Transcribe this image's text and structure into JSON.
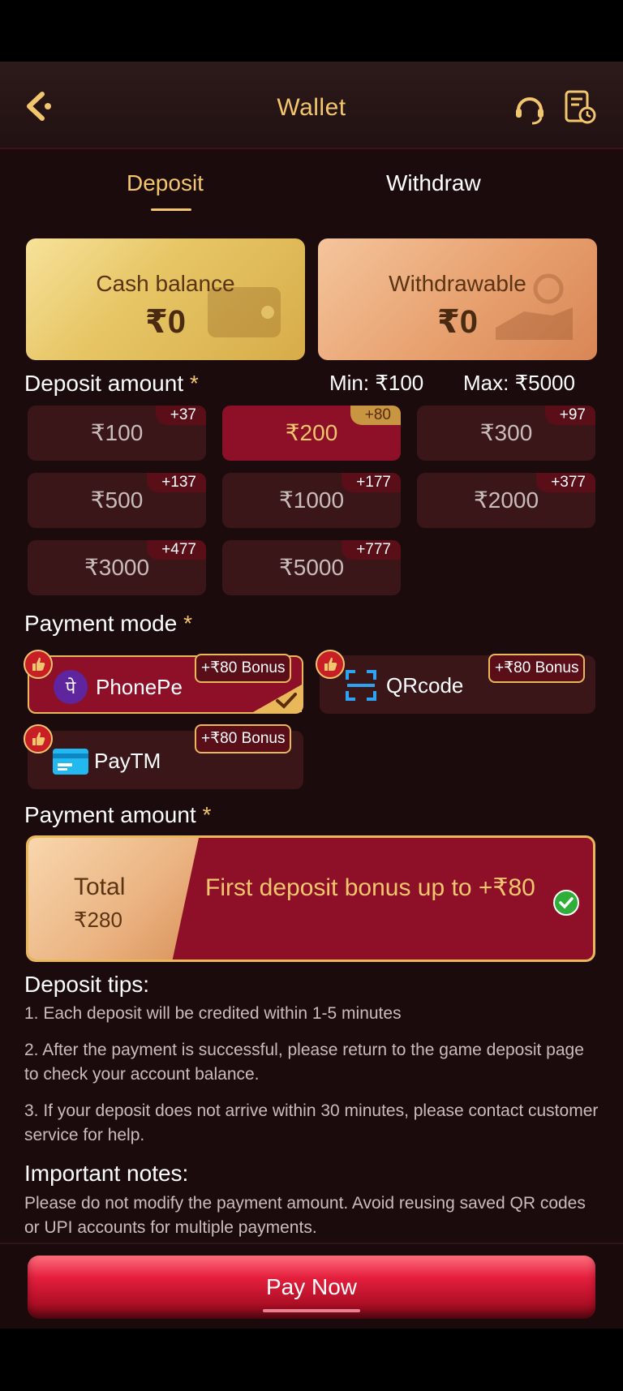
{
  "header": {
    "title": "Wallet",
    "back_icon": "back-arrow-icon",
    "support_icon": "headset-icon",
    "history_icon": "history-icon"
  },
  "tabs": [
    {
      "label": "Deposit",
      "active": true
    },
    {
      "label": "Withdraw",
      "active": false
    }
  ],
  "balances": {
    "cash": {
      "label": "Cash balance",
      "value": "₹0"
    },
    "withdrawable": {
      "label": "Withdrawable",
      "value": "₹0"
    }
  },
  "deposit": {
    "label": "Deposit amount",
    "required_mark": "*",
    "min": "Min: ₹100",
    "max": "Max: ₹5000",
    "amounts": [
      {
        "value": "₹100",
        "bonus": "+37",
        "selected": false
      },
      {
        "value": "₹200",
        "bonus": "+80",
        "selected": true
      },
      {
        "value": "₹300",
        "bonus": "+97",
        "selected": false
      },
      {
        "value": "₹500",
        "bonus": "+137",
        "selected": false
      },
      {
        "value": "₹1000",
        "bonus": "+177",
        "selected": false
      },
      {
        "value": "₹2000",
        "bonus": "+377",
        "selected": false
      },
      {
        "value": "₹3000",
        "bonus": "+477",
        "selected": false
      },
      {
        "value": "₹5000",
        "bonus": "+777",
        "selected": false
      }
    ]
  },
  "payment_mode": {
    "label": "Payment mode",
    "required_mark": "*",
    "options": [
      {
        "name": "PhonePe",
        "bonus": "+₹80 Bonus",
        "selected": true,
        "icon_text": "पे"
      },
      {
        "name": "QRcode",
        "bonus": "+₹80 Bonus",
        "selected": false
      },
      {
        "name": "PayTM",
        "bonus": "+₹80 Bonus",
        "selected": false
      }
    ]
  },
  "payment_amount": {
    "label": "Payment amount",
    "required_mark": "*",
    "total_label": "Total",
    "total_value": "₹280",
    "promo": "First deposit bonus up to +₹80"
  },
  "tips": {
    "title": "Deposit tips:",
    "items": [
      "1. Each deposit will be credited within 1-5 minutes",
      "2. After the payment is successful, please return to the game deposit page to check your account balance.",
      "3. If your deposit does not arrive within 30 minutes, please contact customer service for help."
    ]
  },
  "notes": {
    "title": "Important notes:",
    "text": "Please do not modify the payment amount. Avoid reusing saved QR codes or UPI accounts for multiple payments."
  },
  "pay_button": {
    "label": "Pay Now"
  },
  "colors": {
    "accent_gold": "#f2c66d",
    "selected_red": "#8e1028",
    "background": "#1c0b0c",
    "pay_red": "#e41f3d"
  }
}
